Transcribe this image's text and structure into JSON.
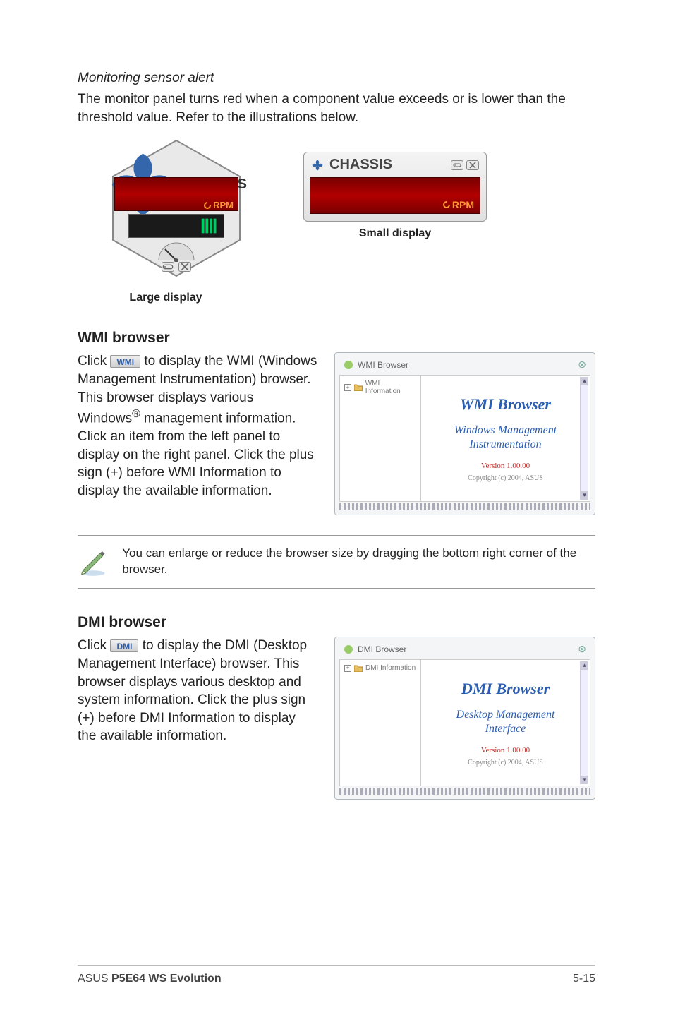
{
  "alert": {
    "heading": "Monitoring sensor alert",
    "body": "The monitor panel turns red when a component value exceeds or is lower than the threshold value. Refer to the illustrations below."
  },
  "gauges": {
    "name": "CHASSIS",
    "unit": "RPM",
    "large_caption": "Large display",
    "small_caption": "Small display"
  },
  "wmi": {
    "heading": "WMI browser",
    "btn_label": "WMI",
    "p1a": "Click ",
    "p1b": " to display the WMI (Windows Management Instrumentation) browser. This browser displays various Windows",
    "p1c": " management information. Click an item from the left panel to display on the right panel. Click the plus sign (+) before WMI Information to display the available information.",
    "window": {
      "title": "WMI Browser",
      "tree": "WMI Information",
      "main_title": "WMI  Browser",
      "sub1": "Windows Management",
      "sub2": "Instrumentation",
      "version": "Version 1.00.00",
      "copyright": "Copyright (c) 2004,  ASUS"
    }
  },
  "note": {
    "text": "You can enlarge or reduce the browser size by dragging the bottom right corner of the browser."
  },
  "dmi": {
    "heading": "DMI browser",
    "btn_label": "DMI",
    "p1a": "Click ",
    "p1b": " to display the DMI (Desktop Management Interface) browser. This browser displays various desktop and system information. Click the plus sign (+) before DMI Information to display the available information.",
    "window": {
      "title": "DMI Browser",
      "tree": "DMI Information",
      "main_title": "DMI  Browser",
      "sub1": "Desktop Management",
      "sub2": "Interface",
      "version": "Version 1.00.00",
      "copyright": "Copyright (c) 2004,  ASUS"
    }
  },
  "footer": {
    "brand": "ASUS ",
    "model": "P5E64 WS Evolution",
    "page": "5-15"
  }
}
